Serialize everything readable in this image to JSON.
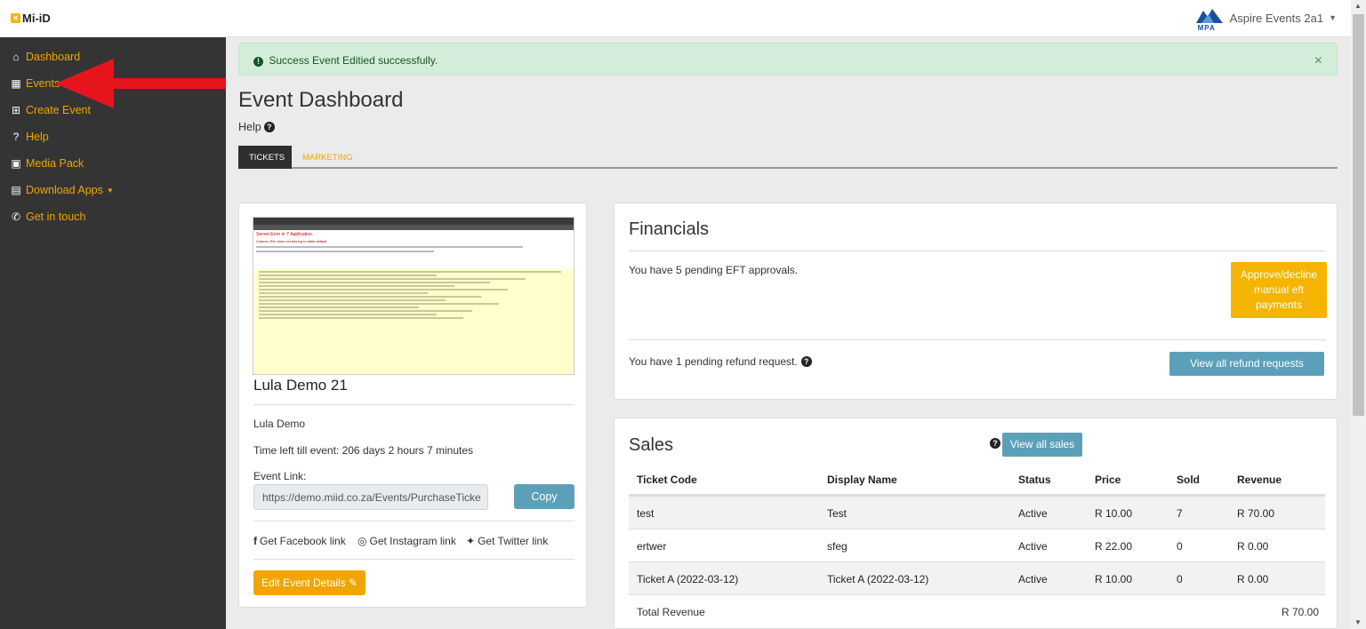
{
  "app": {
    "logo": "Mi-iD"
  },
  "account": {
    "brand": "MPA",
    "name": "Aspire Events 2a1"
  },
  "sidebar": {
    "items": [
      {
        "label": "Dashboard",
        "icon": "home-icon"
      },
      {
        "label": "Events",
        "icon": "calendar-icon"
      },
      {
        "label": "Create Event",
        "icon": "plus-square-icon"
      },
      {
        "label": "Help",
        "icon": "question-circle-icon"
      },
      {
        "label": "Media Pack",
        "icon": "images-icon"
      },
      {
        "label": "Download Apps",
        "icon": "file-download-icon"
      },
      {
        "label": "Get in touch",
        "icon": "phone-icon"
      }
    ]
  },
  "alert": {
    "text": "Success Event Editied successfully.",
    "close": "×"
  },
  "page": {
    "title": "Event Dashboard",
    "help": "Help"
  },
  "tabs": [
    {
      "label": "TICKETS"
    },
    {
      "label": "MARKETING"
    }
  ],
  "event": {
    "thumb_title": "Server Error in '/' Application.",
    "thumb_sub": "Column 'IDs' does not belong to table default.",
    "name": "Lula Demo 21",
    "subtitle": "Lula Demo",
    "time_left": "Time left till event: 206 days 2 hours 7 minutes",
    "link_label": "Event Link:",
    "link_value": "https://demo.miid.co.za/Events/PurchaseTicke",
    "copy_label": "Copy",
    "facebook": "Get Facebook link",
    "instagram": "Get Instagram link",
    "twitter": "Get Twitter link",
    "edit_label": "Edit Event Details"
  },
  "financials": {
    "title": "Financials",
    "eft_text": "You have 5 pending EFT approvals.",
    "approve_label": "Approve/decline manual eft payments",
    "refund_text": "You have 1 pending refund request.",
    "refund_button": "View all refund requests"
  },
  "sales": {
    "title": "Sales",
    "view_button": "View all sales",
    "columns": [
      "Ticket Code",
      "Display Name",
      "Status",
      "Price",
      "Sold",
      "Revenue"
    ],
    "rows": [
      [
        "test",
        "Test",
        "Active",
        "R 10.00",
        "7",
        "R 70.00"
      ],
      [
        "ertwer",
        "sfeg",
        "Active",
        "R 22.00",
        "0",
        "R 0.00"
      ],
      [
        "Ticket A (2022-03-12)",
        "Ticket A (2022-03-12)",
        "Active",
        "R 10.00",
        "0",
        "R 0.00"
      ]
    ],
    "total_label": "Total Revenue",
    "total_value": "R 70.00"
  }
}
